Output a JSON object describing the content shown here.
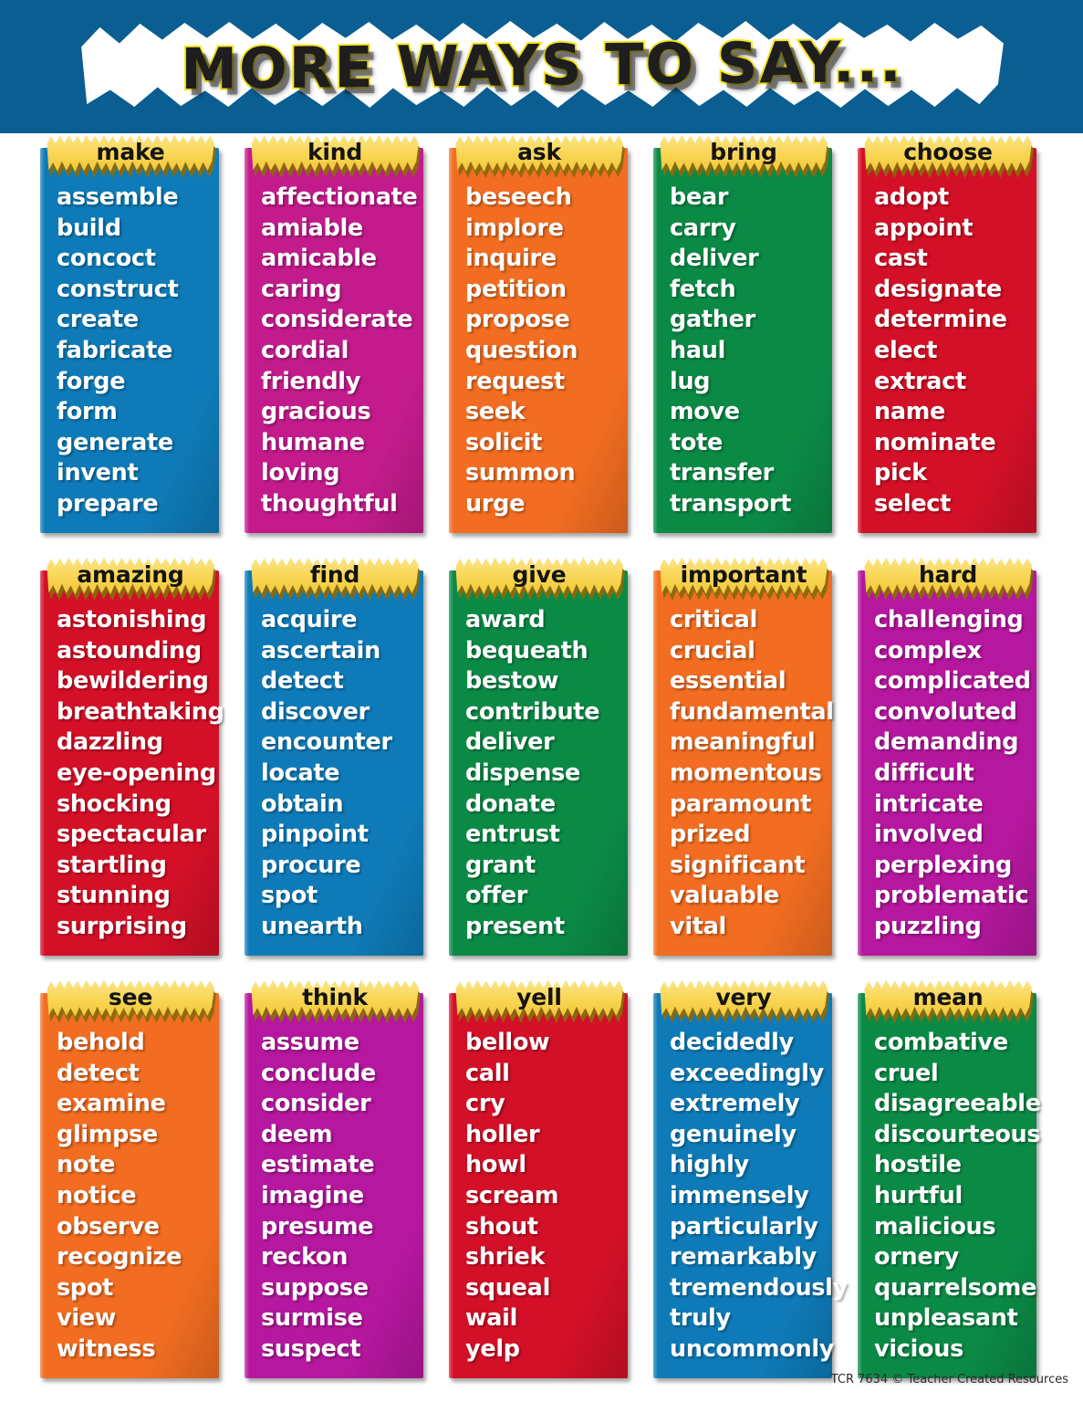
{
  "header": {
    "title": "MORE WAYS TO SAY...",
    "band_color": "#0a5e91",
    "title_fill": "#1e1e1e",
    "title_outline": "#f6e521",
    "banner_color": "#ffffff"
  },
  "tab_style": {
    "fill": "#f9d757",
    "shadow": "#8a6a0d",
    "text_color": "#141414"
  },
  "palette": {
    "blue": "#0e7bb8",
    "magenta": "#c31b8c",
    "orange": "#f26d21",
    "green": "#0b8a46",
    "red": "#d31027",
    "purple": "#b5179e"
  },
  "footer": {
    "credit": "TCR 7634  © Teacher Created Resources"
  },
  "rows": [
    {
      "columns": [
        {
          "heading": "make",
          "color": "#0e7bb8",
          "words": [
            "assemble",
            "build",
            "concoct",
            "construct",
            "create",
            "fabricate",
            "forge",
            "form",
            "generate",
            "invent",
            "prepare"
          ]
        },
        {
          "heading": "kind",
          "color": "#c31b8c",
          "words": [
            "affectionate",
            "amiable",
            "amicable",
            "caring",
            "considerate",
            "cordial",
            "friendly",
            "gracious",
            "humane",
            "loving",
            "thoughtful"
          ]
        },
        {
          "heading": "ask",
          "color": "#f26d21",
          "words": [
            "beseech",
            "implore",
            "inquire",
            "petition",
            "propose",
            "question",
            "request",
            "seek",
            "solicit",
            "summon",
            "urge"
          ]
        },
        {
          "heading": "bring",
          "color": "#0b8a46",
          "words": [
            "bear",
            "carry",
            "deliver",
            "fetch",
            "gather",
            "haul",
            "lug",
            "move",
            "tote",
            "transfer",
            "transport"
          ]
        },
        {
          "heading": "choose",
          "color": "#d31027",
          "words": [
            "adopt",
            "appoint",
            "cast",
            "designate",
            "determine",
            "elect",
            "extract",
            "name",
            "nominate",
            "pick",
            "select"
          ]
        }
      ]
    },
    {
      "columns": [
        {
          "heading": "amazing",
          "color": "#d31027",
          "words": [
            "astonishing",
            "astounding",
            "bewildering",
            "breathtaking",
            "dazzling",
            "eye-opening",
            "shocking",
            "spectacular",
            "startling",
            "stunning",
            "surprising"
          ]
        },
        {
          "heading": "find",
          "color": "#0e7bb8",
          "words": [
            "acquire",
            "ascertain",
            "detect",
            "discover",
            "encounter",
            "locate",
            "obtain",
            "pinpoint",
            "procure",
            "spot",
            "unearth"
          ]
        },
        {
          "heading": "give",
          "color": "#0b8a46",
          "words": [
            "award",
            "bequeath",
            "bestow",
            "contribute",
            "deliver",
            "dispense",
            "donate",
            "entrust",
            "grant",
            "offer",
            "present"
          ]
        },
        {
          "heading": "important",
          "color": "#f26d21",
          "words": [
            "critical",
            "crucial",
            "essential",
            "fundamental",
            "meaningful",
            "momentous",
            "paramount",
            "prized",
            "significant",
            "valuable",
            "vital"
          ]
        },
        {
          "heading": "hard",
          "color": "#b5179e",
          "words": [
            "challenging",
            "complex",
            "complicated",
            "convoluted",
            "demanding",
            "difficult",
            "intricate",
            "involved",
            "perplexing",
            "problematic",
            "puzzling"
          ]
        }
      ]
    },
    {
      "columns": [
        {
          "heading": "see",
          "color": "#f26d21",
          "words": [
            "behold",
            "detect",
            "examine",
            "glimpse",
            "note",
            "notice",
            "observe",
            "recognize",
            "spot",
            "view",
            "witness"
          ]
        },
        {
          "heading": "think",
          "color": "#b5179e",
          "words": [
            "assume",
            "conclude",
            "consider",
            "deem",
            "estimate",
            "imagine",
            "presume",
            "reckon",
            "suppose",
            "surmise",
            "suspect"
          ]
        },
        {
          "heading": "yell",
          "color": "#d31027",
          "words": [
            "bellow",
            "call",
            "cry",
            "holler",
            "howl",
            "scream",
            "shout",
            "shriek",
            "squeal",
            "wail",
            "yelp"
          ]
        },
        {
          "heading": "very",
          "color": "#0e7bb8",
          "words": [
            "decidedly",
            "exceedingly",
            "extremely",
            "genuinely",
            "highly",
            "immensely",
            "particularly",
            "remarkably",
            "tremendously",
            "truly",
            "uncommonly"
          ]
        },
        {
          "heading": "mean",
          "color": "#0b8a46",
          "words": [
            "combative",
            "cruel",
            "disagreeable",
            "discourteous",
            "hostile",
            "hurtful",
            "malicious",
            "ornery",
            "quarrelsome",
            "unpleasant",
            "vicious"
          ]
        }
      ]
    }
  ]
}
